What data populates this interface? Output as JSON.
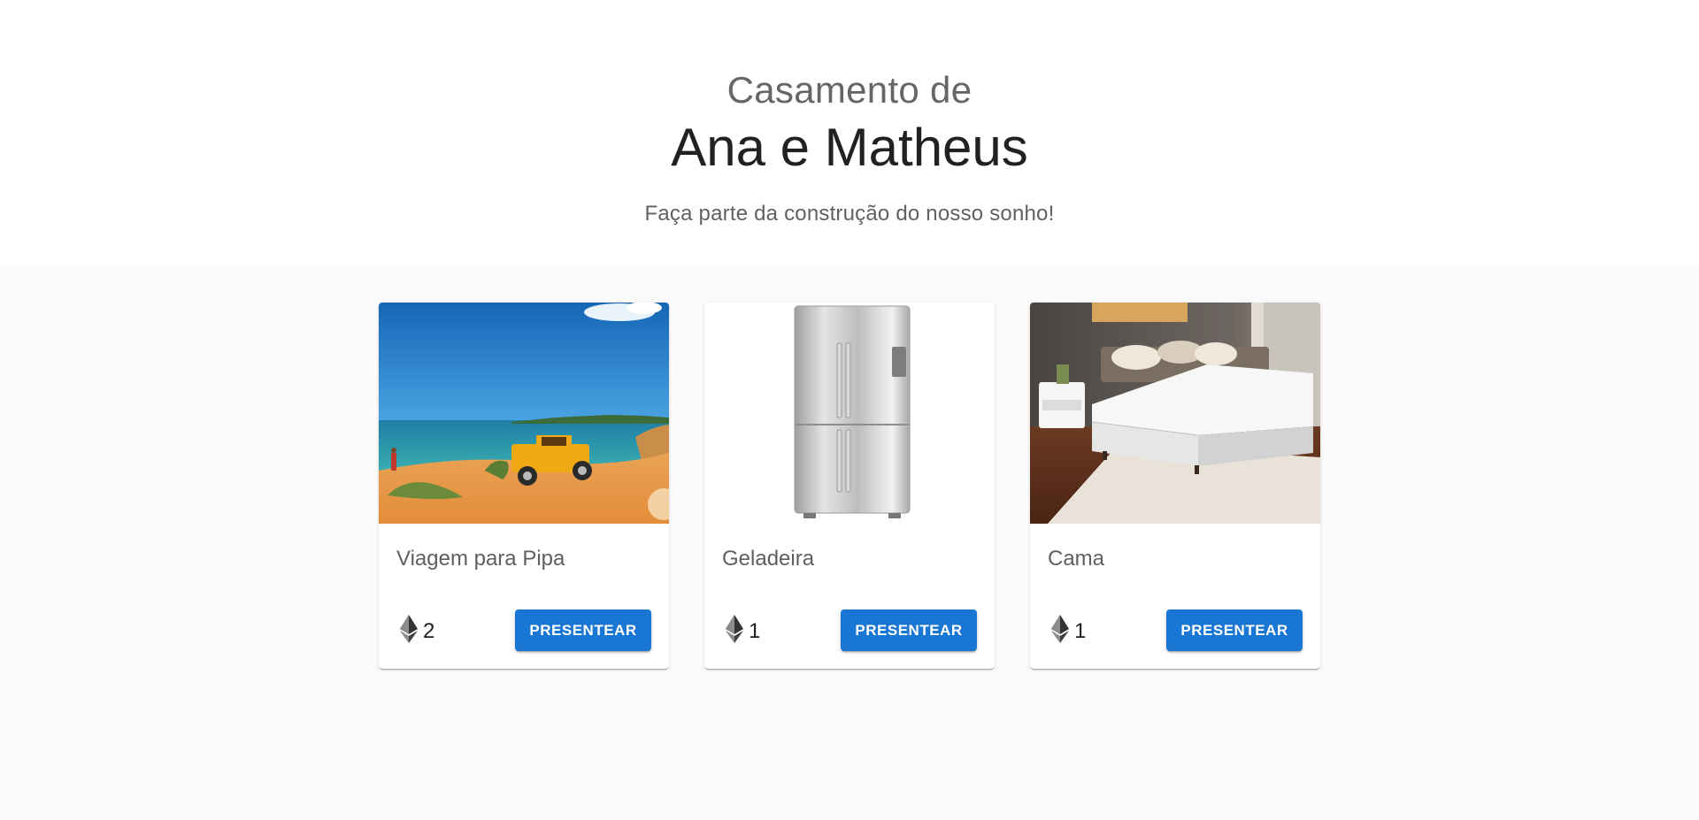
{
  "hero": {
    "pre_title": "Casamento de",
    "couple": "Ana e Matheus",
    "tagline": "Faça parte da construção do nosso sonho!"
  },
  "gifts": [
    {
      "title": "Viagem para Pipa",
      "price": "2",
      "currency_icon": "ethereum-icon",
      "button_label": "PRESENTEAR",
      "image": "beach-jeep-photo"
    },
    {
      "title": "Geladeira",
      "price": "1",
      "currency_icon": "ethereum-icon",
      "button_label": "PRESENTEAR",
      "image": "refrigerator-photo"
    },
    {
      "title": "Cama",
      "price": "1",
      "currency_icon": "ethereum-icon",
      "button_label": "PRESENTEAR",
      "image": "bed-photo"
    }
  ],
  "colors": {
    "primary": "#1976d2",
    "background": "#fafafa",
    "card": "#ffffff"
  }
}
